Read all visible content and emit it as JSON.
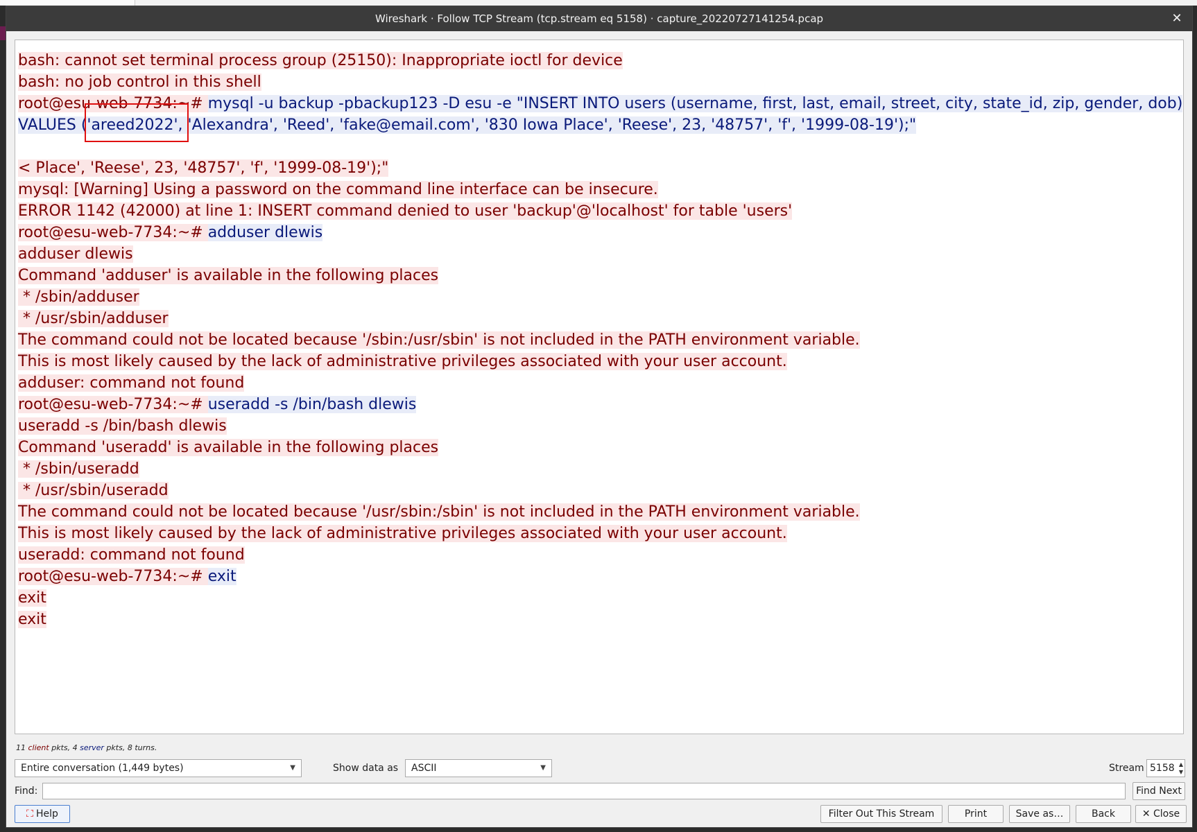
{
  "window": {
    "title": "Wireshark · Follow TCP Stream (tcp.stream eq 5158) · capture_20220727141254.pcap",
    "close_glyph": "✕"
  },
  "colors": {
    "client_text": "#7a0000",
    "client_bg": "#fbe6e6",
    "server_text": "#0a1a7a",
    "server_bg": "#e8ecf8",
    "highlight_border": "#e01010"
  },
  "stream": {
    "lines": [
      {
        "t": "c",
        "text": "bash: cannot set terminal process group (25150): Inappropriate ioctl for device"
      },
      {
        "t": "c",
        "text": "bash: no job control in this shell"
      },
      {
        "t": "mix",
        "prompt": "root@esu-web-7734:~# ",
        "cmd": "mysql -u backup -pbackup123 -D esu -e \"INSERT INTO users (username, first, last, email, street, city, state_id, zip, gender, dob)"
      },
      {
        "t": "s",
        "text": "VALUES ('areed2022', 'Alexandra', 'Reed', 'fake@email.com', '830 Iowa Place', 'Reese', 23, '48757', 'f', '1999-08-19');\""
      },
      {
        "t": "blank",
        "text": ""
      },
      {
        "t": "c",
        "text": "< Place', 'Reese', 23, '48757', 'f', '1999-08-19');\""
      },
      {
        "t": "c",
        "text": "mysql: [Warning] Using a password on the command line interface can be insecure."
      },
      {
        "t": "c",
        "text": "ERROR 1142 (42000) at line 1: INSERT command denied to user 'backup'@'localhost' for table 'users'"
      },
      {
        "t": "mix",
        "prompt": "root@esu-web-7734:~# ",
        "cmd": "adduser dlewis"
      },
      {
        "t": "c",
        "text": "adduser dlewis"
      },
      {
        "t": "c",
        "text": "Command 'adduser' is available in the following places"
      },
      {
        "t": "c",
        "text": " * /sbin/adduser"
      },
      {
        "t": "c",
        "text": " * /usr/sbin/adduser"
      },
      {
        "t": "c",
        "text": "The command could not be located because '/sbin:/usr/sbin' is not included in the PATH environment variable."
      },
      {
        "t": "c",
        "text": "This is most likely caused by the lack of administrative privileges associated with your user account."
      },
      {
        "t": "c",
        "text": "adduser: command not found"
      },
      {
        "t": "mix",
        "prompt": "root@esu-web-7734:~# ",
        "cmd": "useradd -s /bin/bash dlewis"
      },
      {
        "t": "c",
        "text": "useradd -s /bin/bash dlewis"
      },
      {
        "t": "c",
        "text": "Command 'useradd' is available in the following places"
      },
      {
        "t": "c",
        "text": " * /sbin/useradd"
      },
      {
        "t": "c",
        "text": " * /usr/sbin/useradd"
      },
      {
        "t": "c",
        "text": "The command could not be located because '/usr/sbin:/sbin' is not included in the PATH environment variable."
      },
      {
        "t": "c",
        "text": "This is most likely caused by the lack of administrative privileges associated with your user account."
      },
      {
        "t": "c",
        "text": "useradd: command not found"
      },
      {
        "t": "mix",
        "prompt": "root@esu-web-7734:~# ",
        "cmd": "exit"
      },
      {
        "t": "c",
        "text": "exit"
      },
      {
        "t": "c",
        "text": "exit"
      }
    ]
  },
  "stats": {
    "client_count": "11",
    "client_word": "client",
    "pkts_sep": " pkts, ",
    "server_count": "4",
    "server_word": "server",
    "tail": " pkts, 8 turns."
  },
  "controls": {
    "conversation_select": "Entire conversation (1,449 bytes)",
    "show_data_label": "Show data as",
    "show_data_select": "ASCII",
    "stream_label": "Stream",
    "stream_value": "5158"
  },
  "find": {
    "label": "Find:",
    "value": "",
    "find_next": "Find Next"
  },
  "buttons": {
    "help": "Help",
    "help_icon": "help-icon",
    "filter_out": "Filter Out This Stream",
    "print": "Print",
    "save_as": "Save as…",
    "back": "Back",
    "close": "Close",
    "close_icon": "✕"
  }
}
